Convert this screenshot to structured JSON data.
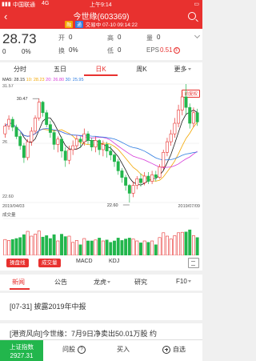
{
  "status_bar": {
    "carrier": "中国联通",
    "network": "4G",
    "time": "上午9:14"
  },
  "header": {
    "title": "今世缘(603369)",
    "badge1": "融",
    "badge2": "通",
    "subtitle": "交易中 07-10 09:14:22"
  },
  "quote": {
    "price": "28.73",
    "change": "0",
    "change_pct": "0%",
    "open_label": "开",
    "open_value": "0",
    "high_label": "高",
    "high_value": "0",
    "turnover_label": "换",
    "turnover_value": "0%",
    "low_label": "低",
    "low_value": "0",
    "volume_label": "量",
    "volume_value": "0",
    "eps_label": "EPS",
    "eps_value": "0.51",
    "eps_icon": "①"
  },
  "period_tabs": [
    {
      "label": "分时"
    },
    {
      "label": "五日"
    },
    {
      "label": "日K"
    },
    {
      "label": "周K"
    },
    {
      "label": "更多"
    }
  ],
  "chart": {
    "ma_prefix": "MA5: 28.15",
    "ma10": "10: 28.23",
    "ma20": "20: 26.80",
    "ma30": "30: 25.95",
    "prev_restore": "前复权",
    "y_top": "31.57",
    "y_bottom": "22.60",
    "y_mid": "26",
    "high_marker": "30.47",
    "low_marker": "22.60",
    "date_start": "2019/04/03",
    "date_end": "2019/07/09",
    "volume_label": "成交量",
    "colors": {
      "up": "#e8312f",
      "down": "#22b64c",
      "ma5": "#1a1a1a",
      "ma10": "#f3a700",
      "ma20": "#d63ad8",
      "ma30": "#2f7de1"
    }
  },
  "chart_data": {
    "type": "candlestick",
    "dates": [
      "2019/04/03",
      "2019/07/09"
    ],
    "ylim": [
      22.6,
      31.57
    ],
    "high": 30.47,
    "low": 22.6,
    "candles": [
      [
        27.8,
        28.4,
        27.5,
        28.6
      ],
      [
        28.4,
        28.9,
        28.1,
        29.2
      ],
      [
        28.9,
        28.3,
        28.0,
        29.1
      ],
      [
        28.3,
        27.6,
        27.4,
        28.5
      ],
      [
        27.6,
        26.9,
        26.6,
        27.9
      ],
      [
        26.9,
        26.0,
        25.6,
        27.1
      ],
      [
        26.0,
        27.2,
        25.8,
        27.4
      ],
      [
        27.2,
        28.0,
        26.9,
        28.3
      ],
      [
        28.0,
        29.0,
        27.8,
        29.2
      ],
      [
        29.0,
        30.2,
        28.8,
        30.47
      ],
      [
        30.2,
        29.4,
        29.1,
        30.3
      ],
      [
        29.4,
        28.5,
        28.3,
        29.6
      ],
      [
        28.5,
        27.9,
        27.5,
        28.8
      ],
      [
        27.9,
        27.0,
        26.6,
        28.1
      ],
      [
        27.0,
        27.4,
        26.4,
        27.6
      ],
      [
        27.4,
        26.5,
        26.0,
        27.6
      ],
      [
        26.5,
        25.8,
        25.3,
        26.8
      ],
      [
        25.8,
        26.6,
        25.5,
        26.9
      ],
      [
        26.6,
        26.9,
        26.2,
        27.3
      ],
      [
        26.9,
        27.4,
        26.6,
        27.7
      ],
      [
        27.4,
        27.2,
        26.8,
        27.6
      ],
      [
        27.2,
        27.8,
        26.9,
        28.2
      ],
      [
        27.8,
        27.3,
        27.0,
        28.0
      ],
      [
        27.3,
        26.8,
        26.5,
        27.5
      ],
      [
        26.8,
        27.3,
        26.4,
        27.6
      ],
      [
        27.3,
        26.6,
        26.2,
        27.4
      ],
      [
        26.6,
        27.0,
        26.1,
        27.3
      ],
      [
        27.0,
        26.5,
        26.0,
        27.2
      ],
      [
        26.5,
        26.2,
        25.8,
        26.9
      ],
      [
        26.2,
        25.7,
        25.3,
        26.3
      ],
      [
        25.7,
        25.0,
        24.7,
        25.9
      ],
      [
        25.0,
        24.5,
        24.1,
        25.2
      ],
      [
        24.5,
        23.9,
        23.5,
        24.7
      ],
      [
        23.9,
        23.3,
        22.6,
        24.0
      ],
      [
        23.3,
        23.9,
        23.0,
        24.2
      ],
      [
        23.9,
        24.4,
        23.6,
        24.6
      ],
      [
        24.4,
        24.1,
        23.8,
        24.8
      ],
      [
        24.1,
        24.6,
        23.9,
        24.9
      ],
      [
        24.6,
        24.2,
        24.0,
        24.9
      ],
      [
        24.2,
        24.7,
        24.0,
        25.0
      ],
      [
        24.7,
        24.5,
        24.2,
        25.0
      ],
      [
        24.5,
        25.3,
        24.4,
        25.5
      ],
      [
        25.3,
        26.4,
        25.1,
        26.6
      ],
      [
        26.4,
        27.2,
        26.1,
        27.5
      ],
      [
        27.2,
        27.8,
        26.9,
        28.1
      ],
      [
        27.8,
        28.6,
        27.5,
        29.0
      ],
      [
        28.6,
        29.6,
        28.3,
        30.0
      ],
      [
        29.6,
        30.6,
        29.2,
        31.0
      ],
      [
        30.6,
        29.8,
        29.3,
        31.57
      ],
      [
        29.8,
        28.6,
        28.2,
        30.1
      ],
      [
        28.6,
        29.4,
        28.3,
        29.8
      ],
      [
        29.4,
        28.7,
        28.4,
        29.7
      ]
    ]
  },
  "indicator_tabs": {
    "btn1": "操盘线",
    "btn2": "成交量",
    "t1": "MACD",
    "t2": "KDJ"
  },
  "news_tabs": [
    {
      "label": "新闻"
    },
    {
      "label": "公告"
    },
    {
      "label": "龙虎"
    },
    {
      "label": "研究"
    },
    {
      "label": "F10"
    }
  ],
  "news": [
    {
      "text": "[07-31]   披露2019年中报"
    },
    {
      "text": "[港资风向]今世缘：7月9日净卖出50.01万股 约"
    }
  ],
  "bottom_bar": {
    "index_name": "上证指数",
    "index_value": "2927.31",
    "ask": "问股",
    "ask_icon": "?",
    "buy": "买入",
    "watch": "自选"
  }
}
